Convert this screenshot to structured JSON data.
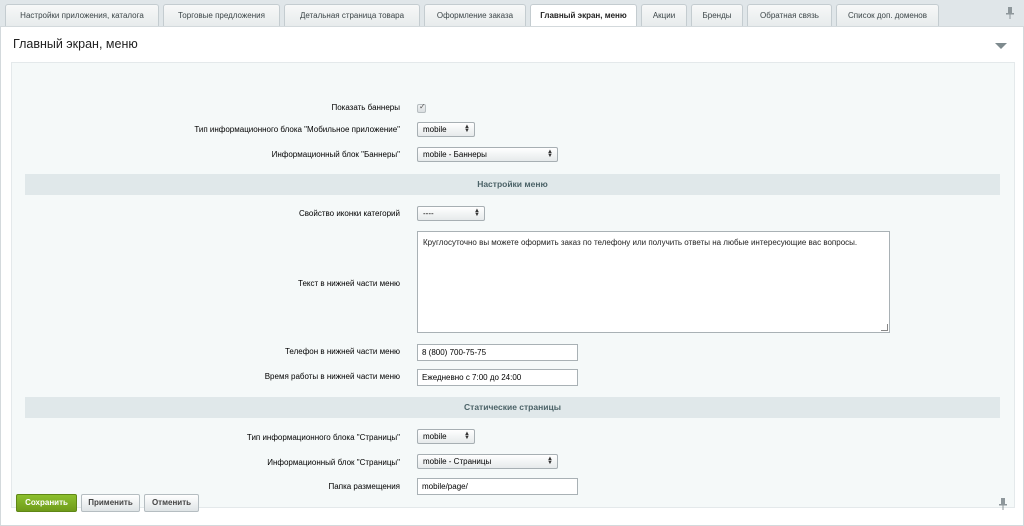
{
  "tabs": [
    {
      "label": "Настройки приложения, каталога"
    },
    {
      "label": "Торговые предложения"
    },
    {
      "label": "Детальная страница товара"
    },
    {
      "label": "Оформление заказа"
    },
    {
      "label": "Главный экран, меню"
    },
    {
      "label": "Акции"
    },
    {
      "label": "Бренды"
    },
    {
      "label": "Обратная связь"
    },
    {
      "label": "Список доп. доменов"
    }
  ],
  "active_tab": "Главный экран, меню",
  "section_title": "Главный экран, меню",
  "form": {
    "show_banners_label": "Показать баннеры",
    "show_banners_checked": true,
    "mobile_iblock_type_label": "Тип информационного блока \"Мобильное приложение\"",
    "mobile_iblock_type_value": "mobile",
    "banners_iblock_label": "Информационный блок \"Баннеры\"",
    "banners_iblock_value": "mobile - Баннеры"
  },
  "menu_section": {
    "header": "Настройки меню",
    "category_icon_label": "Свойство иконки категорий",
    "category_icon_value": "----",
    "bottom_text_label": "Текст в нижней части меню",
    "bottom_text_value": "Круглосуточно вы можете оформить заказ по телефону или получить ответы на любые интересующие вас вопросы.",
    "phone_label": "Телефон в нижней части меню",
    "phone_value": "8 (800) 700-75-75",
    "hours_label": "Время работы в нижней части меню",
    "hours_value": "Ежедневно с 7:00 до 24:00"
  },
  "static_section": {
    "header": "Статические страницы",
    "iblock_type_label": "Тип информационного блока \"Страницы\"",
    "iblock_type_value": "mobile",
    "iblock_label": "Информационный блок \"Страницы\"",
    "iblock_value": "mobile - Страницы",
    "folder_label": "Папка размещения",
    "folder_value": "mobile/page/"
  },
  "buttons": {
    "save": "Сохранить",
    "apply": "Применить",
    "cancel": "Отменить"
  },
  "colors": {
    "save_button": "#7cab22",
    "section_header_bg": "#e0e8ea",
    "section_header_text": "#4b6267"
  },
  "icons": {
    "pin": "pin-icon",
    "collapse": "chevron-down-icon",
    "dropdown": "updown-arrows-icon"
  }
}
